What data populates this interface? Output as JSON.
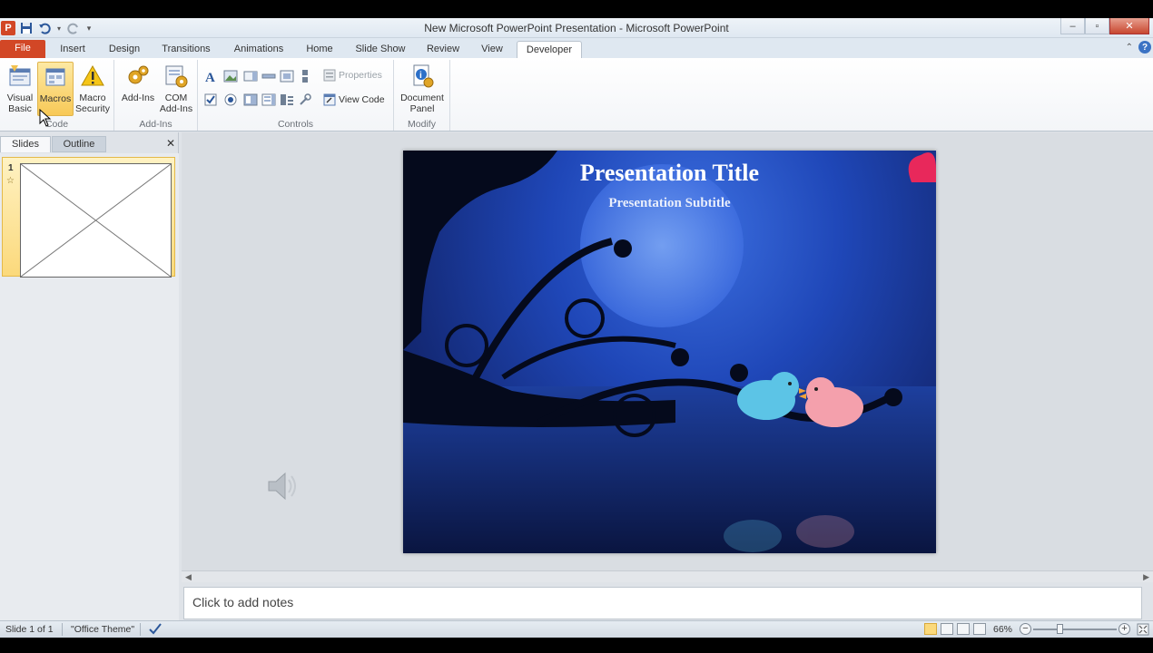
{
  "window": {
    "title": "New Microsoft PowerPoint Presentation  -  Microsoft PowerPoint",
    "app_icon_letter": "P",
    "controls": {
      "minimize": "–",
      "maximize": "▫",
      "close": "✕"
    }
  },
  "tabs": [
    {
      "label": "File"
    },
    {
      "label": "Insert"
    },
    {
      "label": "Design"
    },
    {
      "label": "Transitions"
    },
    {
      "label": "Animations"
    },
    {
      "label": "Home"
    },
    {
      "label": "Slide Show"
    },
    {
      "label": "Review"
    },
    {
      "label": "View"
    },
    {
      "label": "Developer"
    }
  ],
  "active_tab": "Developer",
  "ribbon": {
    "code": {
      "label": "Code",
      "visual_basic": "Visual Basic",
      "macros": "Macros",
      "macro_security": "Macro Security"
    },
    "addins": {
      "label": "Add-Ins",
      "addins_btn": "Add-Ins",
      "com_addins": "COM Add-Ins"
    },
    "controls": {
      "label": "Controls",
      "properties": "Properties",
      "view_code": "View Code"
    },
    "modify": {
      "label": "Modify",
      "document_panel": "Document Panel"
    }
  },
  "leftpane": {
    "tabs": [
      "Slides",
      "Outline"
    ],
    "close": "✕",
    "slides": [
      {
        "number": "1",
        "star": "☆"
      }
    ]
  },
  "slide": {
    "title": "Presentation Title",
    "subtitle": "Presentation Subtitle"
  },
  "notes": {
    "placeholder": "Click to add notes"
  },
  "status": {
    "slide_info": "Slide 1 of 1",
    "theme": "\"Office Theme\"",
    "zoom": "66%",
    "zoom_minus": "−",
    "zoom_plus": "+"
  }
}
